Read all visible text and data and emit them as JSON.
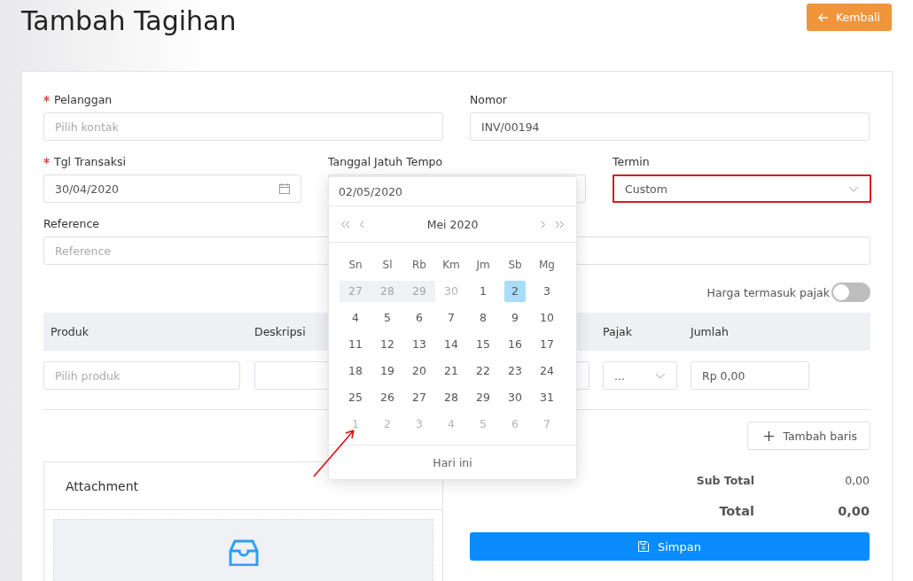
{
  "page": {
    "title": "Tambah Tagihan",
    "back_button": "Kembali"
  },
  "form": {
    "customer": {
      "label": "Pelanggan",
      "required": true,
      "placeholder": "Pilih kontak"
    },
    "number": {
      "label": "Nomor",
      "required": false,
      "value": "INV/00194"
    },
    "transaction_date": {
      "label": "Tgl Transaksi",
      "required": true,
      "value": "30/04/2020"
    },
    "due_date": {
      "label": "Tanggal Jatuh Tempo",
      "required": false
    },
    "term": {
      "label": "Termin",
      "value": "Custom",
      "highlighted": true
    },
    "reference": {
      "label": "Reference",
      "required": false,
      "placeholder": "Reference"
    }
  },
  "tax_toggle": {
    "label": "Harga termasuk pajak",
    "on": false
  },
  "items_table": {
    "columns": [
      {
        "label": "Produk"
      },
      {
        "label": "Deskripsi"
      },
      {
        "label": "Pajak"
      },
      {
        "label": "Jumlah"
      }
    ],
    "row": {
      "product_placeholder": "Pilih produk",
      "tax_value": "...",
      "amount": "Rp 0,00"
    }
  },
  "add_row_button": "Tambah baris",
  "attachment": {
    "title": "Attachment"
  },
  "totals": [
    {
      "kind": "subtotal",
      "label": "Sub Total",
      "value": "0,00"
    },
    {
      "kind": "total",
      "label": "Total",
      "value": "0,00"
    }
  ],
  "save_button": "Simpan",
  "date_picker": {
    "input_value": "02/05/2020",
    "month_label": "Mei 2020",
    "weekdays": [
      "Sn",
      "Sl",
      "Rb",
      "Km",
      "Jm",
      "Sb",
      "Mg"
    ],
    "weeks": [
      [
        {
          "d": "27",
          "outside": true,
          "in_range": true,
          "selected": false
        },
        {
          "d": "28",
          "outside": true,
          "in_range": true,
          "selected": false
        },
        {
          "d": "29",
          "outside": true,
          "in_range": true,
          "selected": false
        },
        {
          "d": "30",
          "outside": true,
          "in_range": false,
          "selected": false
        },
        {
          "d": "1",
          "outside": false,
          "in_range": false,
          "selected": false
        },
        {
          "d": "2",
          "outside": false,
          "in_range": false,
          "selected": true
        },
        {
          "d": "3",
          "outside": false,
          "in_range": false,
          "selected": false
        }
      ],
      [
        {
          "d": "4",
          "outside": false,
          "in_range": false,
          "selected": false
        },
        {
          "d": "5",
          "outside": false,
          "in_range": false,
          "selected": false
        },
        {
          "d": "6",
          "outside": false,
          "in_range": false,
          "selected": false
        },
        {
          "d": "7",
          "outside": false,
          "in_range": false,
          "selected": false
        },
        {
          "d": "8",
          "outside": false,
          "in_range": false,
          "selected": false
        },
        {
          "d": "9",
          "outside": false,
          "in_range": false,
          "selected": false
        },
        {
          "d": "10",
          "outside": false,
          "in_range": false,
          "selected": false
        }
      ],
      [
        {
          "d": "11",
          "outside": false,
          "in_range": false,
          "selected": false
        },
        {
          "d": "12",
          "outside": false,
          "in_range": false,
          "selected": false
        },
        {
          "d": "13",
          "outside": false,
          "in_range": false,
          "selected": false
        },
        {
          "d": "14",
          "outside": false,
          "in_range": false,
          "selected": false
        },
        {
          "d": "15",
          "outside": false,
          "in_range": false,
          "selected": false
        },
        {
          "d": "16",
          "outside": false,
          "in_range": false,
          "selected": false
        },
        {
          "d": "17",
          "outside": false,
          "in_range": false,
          "selected": false
        }
      ],
      [
        {
          "d": "18",
          "outside": false,
          "in_range": false,
          "selected": false
        },
        {
          "d": "19",
          "outside": false,
          "in_range": false,
          "selected": false
        },
        {
          "d": "20",
          "outside": false,
          "in_range": false,
          "selected": false
        },
        {
          "d": "21",
          "outside": false,
          "in_range": false,
          "selected": false
        },
        {
          "d": "22",
          "outside": false,
          "in_range": false,
          "selected": false
        },
        {
          "d": "23",
          "outside": false,
          "in_range": false,
          "selected": false
        },
        {
          "d": "24",
          "outside": false,
          "in_range": false,
          "selected": false
        }
      ],
      [
        {
          "d": "25",
          "outside": false,
          "in_range": false,
          "selected": false
        },
        {
          "d": "26",
          "outside": false,
          "in_range": false,
          "selected": false
        },
        {
          "d": "27",
          "outside": false,
          "in_range": false,
          "selected": false
        },
        {
          "d": "28",
          "outside": false,
          "in_range": false,
          "selected": false
        },
        {
          "d": "29",
          "outside": false,
          "in_range": false,
          "selected": false
        },
        {
          "d": "30",
          "outside": false,
          "in_range": false,
          "selected": false
        },
        {
          "d": "31",
          "outside": false,
          "in_range": false,
          "selected": false
        }
      ],
      [
        {
          "d": "1",
          "outside": true,
          "in_range": false,
          "selected": false
        },
        {
          "d": "2",
          "outside": true,
          "in_range": false,
          "selected": false
        },
        {
          "d": "3",
          "outside": true,
          "in_range": false,
          "selected": false
        },
        {
          "d": "4",
          "outside": true,
          "in_range": false,
          "selected": false
        },
        {
          "d": "5",
          "outside": true,
          "in_range": false,
          "selected": false
        },
        {
          "d": "6",
          "outside": true,
          "in_range": false,
          "selected": false
        },
        {
          "d": "7",
          "outside": true,
          "in_range": false,
          "selected": false
        }
      ]
    ],
    "today_button": "Hari ini"
  }
}
